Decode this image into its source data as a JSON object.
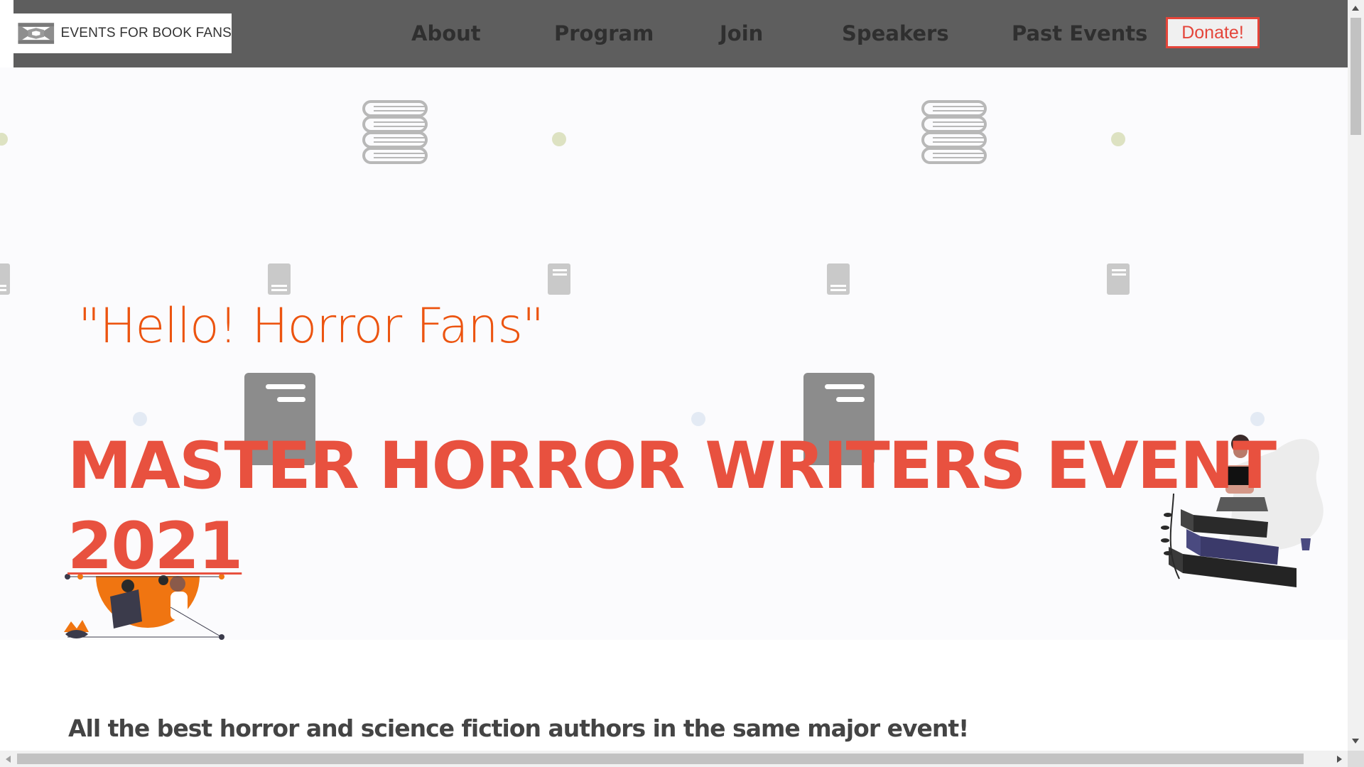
{
  "header": {
    "logo_text": "EVENTS FOR BOOK FANS",
    "nav": [
      {
        "label": "About"
      },
      {
        "label": "Program"
      },
      {
        "label": "Join"
      },
      {
        "label": "Speakers"
      },
      {
        "label": "Past Events"
      }
    ],
    "donate_label": "Donate!"
  },
  "hero": {
    "greeting": "\"Hello! Horror Fans\"",
    "headline_line1": "MASTER HORROR WRITERS EVENT",
    "headline_line2": "2021",
    "subtitle": "All the best horror and science fiction authors in the same major event!"
  },
  "colors": {
    "header_bg": "#5e5e5e",
    "accent_red": "#e8513f",
    "accent_orange": "#ec5410",
    "hero_bg": "#fbfbfd"
  },
  "icons": {
    "pattern": [
      "book-stack-icon",
      "book-icon",
      "dot-icon"
    ],
    "illustrations": [
      "woman-reading-on-books-illustration",
      "reader-orange-circle-illustration"
    ]
  }
}
